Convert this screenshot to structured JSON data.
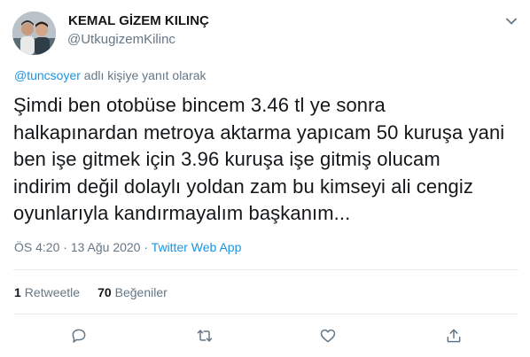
{
  "user": {
    "display_name": "KEMAL GİZEM KILINÇ",
    "handle": "@UtkugizemKilinc"
  },
  "reply": {
    "mention": "@tuncsoyer",
    "suffix": " adlı kişiye yanıt olarak"
  },
  "tweet": {
    "text": "Şimdi ben otobüse bincem 3.46 tl ye sonra\nhalkapınardan metroya aktarma yapıcam 50 kuruşa yani\nben işe gitmek için 3.96 kuruşa işe gitmiş olucam\nindirim değil dolaylı yoldan zam bu kimseyi ali cengiz\noyunlarıyla kandırmayalım başkanım..."
  },
  "meta": {
    "time": "ÖS 4:20",
    "separator1": " · ",
    "date": "13 Ağu 2020",
    "separator2": " · ",
    "source": "Twitter Web App"
  },
  "stats": {
    "retweet_count": "1",
    "retweet_label": "Retweetle",
    "like_count": "70",
    "like_label": "Beğeniler"
  },
  "icons": {
    "caret": "chevron-down-icon",
    "reply": "reply-icon",
    "retweet": "retweet-icon",
    "like": "heart-icon",
    "share": "share-icon"
  },
  "colors": {
    "link": "#1b95e0",
    "secondary_text": "#657786",
    "divider": "#e6ecf0"
  }
}
